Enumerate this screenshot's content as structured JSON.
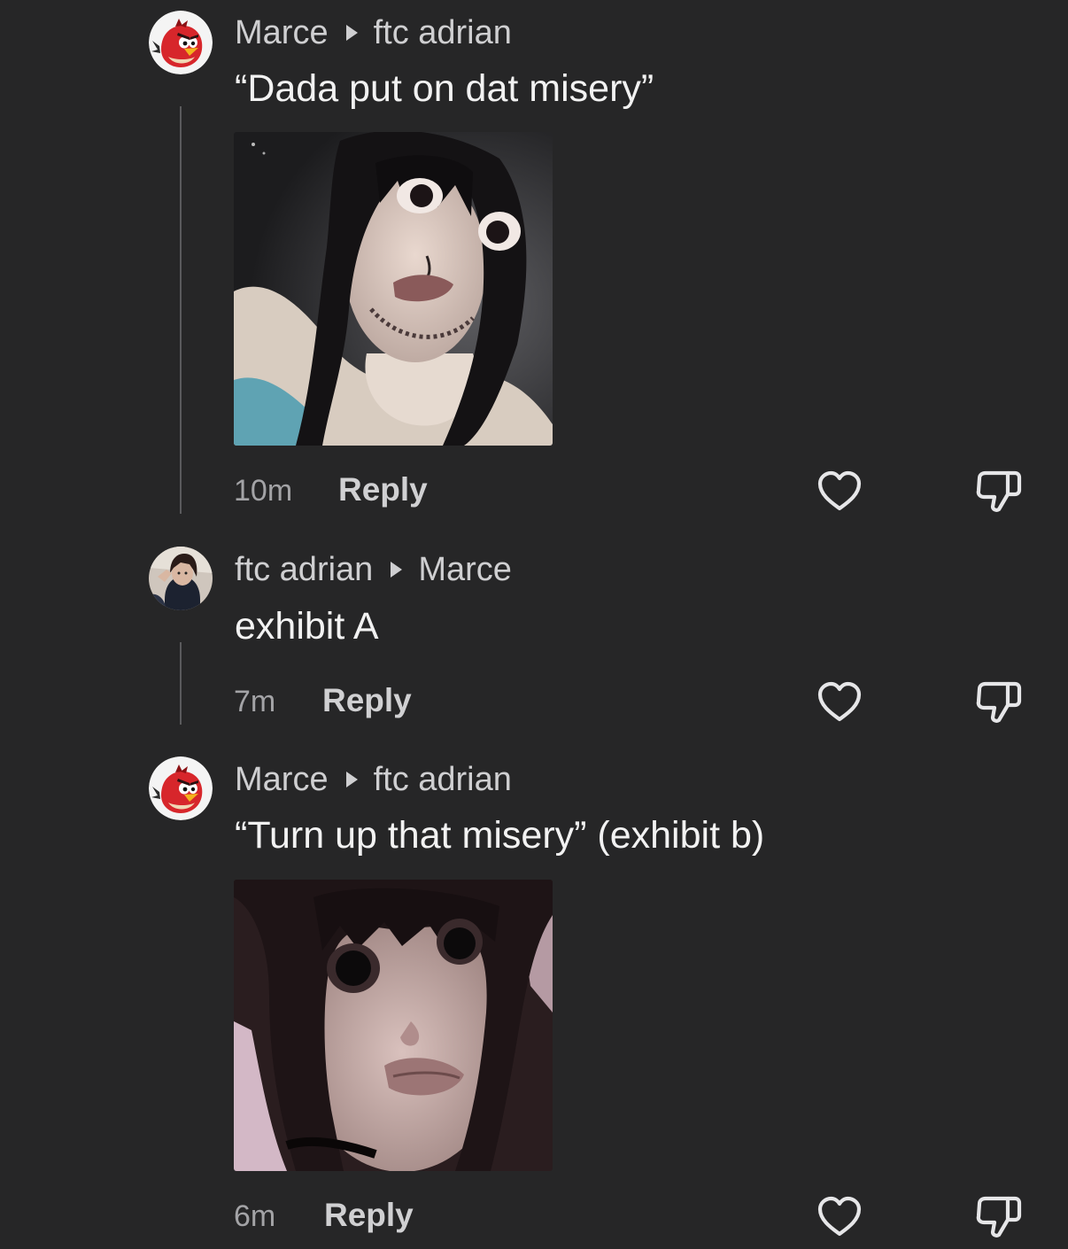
{
  "comments": [
    {
      "author": "Marce",
      "reply_to": "ftc adrian",
      "text": "“Dada put on dat misery”",
      "time": "10m",
      "reply_label": "Reply",
      "avatar_icon": "angry-bird-avatar",
      "has_image": true
    },
    {
      "author": "ftc adrian",
      "reply_to": "Marce",
      "text": "exhibit A",
      "time": "7m",
      "reply_label": "Reply",
      "avatar_icon": "user-photo-avatar",
      "has_image": false
    },
    {
      "author": "Marce",
      "reply_to": "ftc adrian",
      "text": "“Turn up that misery” (exhibit b)",
      "time": "6m",
      "reply_label": "Reply",
      "avatar_icon": "angry-bird-avatar",
      "has_image": true
    }
  ],
  "icons": {
    "like": "heart-icon",
    "dislike": "thumbs-down-icon",
    "reply_arrow": "triangle-right-icon"
  },
  "colors": {
    "background": "#262627",
    "text_primary": "#f2f2f2",
    "text_secondary": "#a3a3a6"
  }
}
